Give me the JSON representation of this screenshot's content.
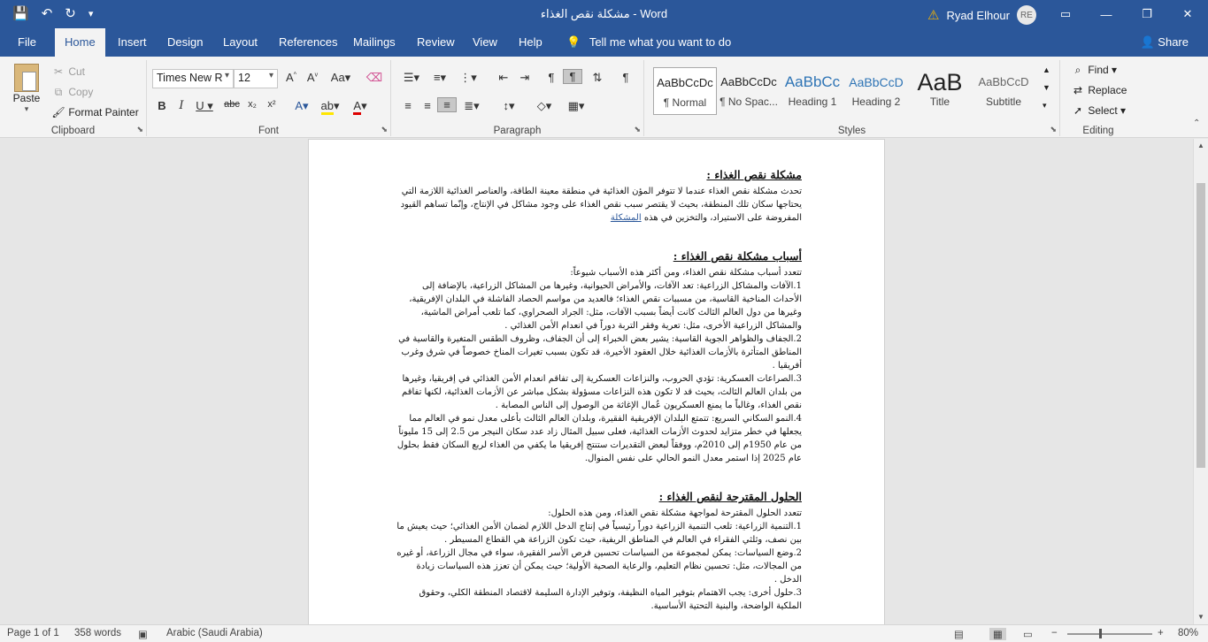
{
  "window": {
    "title": "مشكلة نقص الغذاء  -  Word",
    "user_name": "Ryad Elhour",
    "user_initials": "RE",
    "qat": {
      "save_icon": "💾",
      "undo_icon": "↶",
      "redo_icon": "↻",
      "customize_icon": "▾"
    },
    "warning_icon": "⚠",
    "controls": {
      "ribbon_display_icon": "▭",
      "minimize_icon": "—",
      "restore_icon": "❐",
      "close_icon": "✕"
    }
  },
  "tabs": {
    "items": [
      "File",
      "Home",
      "Insert",
      "Design",
      "Layout",
      "References",
      "Mailings",
      "Review",
      "View",
      "Help"
    ],
    "active": "Home",
    "tell_me": "Tell me what you want to do",
    "share": "Share"
  },
  "clipboard": {
    "paste": "Paste",
    "cut": "Cut",
    "copy": "Copy",
    "format_painter": "Format Painter",
    "label": "Clipboard"
  },
  "font": {
    "name": "Times New R",
    "size": "12",
    "label": "Font"
  },
  "paragraph": {
    "label": "Paragraph"
  },
  "styles": {
    "label": "Styles",
    "items": [
      {
        "preview": "AaBbCcDc",
        "name": "¶ Normal"
      },
      {
        "preview": "AaBbCcDc",
        "name": "¶ No Spac..."
      },
      {
        "preview": "AaBbCc",
        "name": "Heading 1"
      },
      {
        "preview": "AaBbCcD",
        "name": "Heading 2"
      },
      {
        "preview": "AaB",
        "name": "Title"
      },
      {
        "preview": "AaBbCcD",
        "name": "Subtitle"
      }
    ]
  },
  "editing": {
    "find": "Find",
    "replace": "Replace",
    "select": "Select",
    "label": "Editing"
  },
  "document": {
    "h1": "مشكلة نقص الغذاء :",
    "p1": "تحدث مشكلة نقص الغذاء عندما لا تتوفر المؤن الغذائية في منطقة معينة الطاقة، والعناصر الغذائية اللازمة التي يحتاجها سكان تلك المنطقة، بحيث لا يقتصر سبب نقص الغذاء على وجود مشاكل في الإنتاج، وإنّما تساهم القيود المفروضة على الاستيراد، والتخزين في هذه",
    "p1_link": "المشكلة",
    "h2": "أسباب مشكلة نقص الغذاء :",
    "p2_intro": "تتعدد أسباب مشكلة نقص الغذاء، ومن أكثر هذه الأسباب شيوعاً:",
    "p2_1": "1.الآفات والمشاكل الزراعية: تعد الآفات، والأمراض الحيوانية، وغيرها من المشاكل الزراعية، بالإضافة إلى الأحداث المناخية القاسية، من مسببات نقص الغذاء؛ فالعديد من مواسم الحصاد الفاشلة في البلدان الإفريقية، وغيرها من دول العالم الثالث كانت أيضاً بسبب الآفات، مثل: الجراد الصحراوي، كما تلعب أمراض الماشية، والمشاكل الزراعية الأخرى، مثل: تعرية وفقر التربة دوراً في انعدام الأمن الغذائي .",
    "p2_2": "2.الجفاف والظواهر الجوية القاسية: يشير بعض الخبراء إلى أن الجفاف، وظروف الطقس المتغيرة والقاسية في المناطق المتأثرة بالأزمات الغذائية خلال العقود الأخيرة، قد تكون بسبب تغيرات المناخ خصوصاً في شرق وغرب أفريقيا .",
    "p2_3": "3.الصراعات العسكرية: تؤدي الحروب، والنزاعات العسكرية إلى تفاقم انعدام الأمن الغذائي في إفريقيا، وغيرها من بلدان العالم الثالث، بحيث قد لا تكون هذه النزاعات مسؤولة بشكل مباشر عن الأزمات الغذائية، لكنها تفاقم نقص الغذاء، وغالباً ما يمنع العسكريون عُمال الإغاثة من الوصول إلى الناس المصابة .",
    "p2_4": "4.النمو السكاني السريع: تتمتع البلدان الإفريقية الفقيرة، وبلدان العالم الثالث بأعلى معدل نمو في العالم مما يجعلها في خطر متزايد لحدوث الأزمات الغذائية، فعلى سبيل المثال زاد عدد سكان النيجر من 2.5 إلى 15 مليوناً من عام 1950م إلى 2010م، ووفقاً لبعض التقديرات ستنتج إفريقيا ما يكفي من الغذاء لربع السكان فقط بحلول عام 2025 إذا استمر معدل النمو الحالي على نفس المنوال.",
    "h3": "الحلول المقترحة لنقص الغذاء :",
    "p3_intro": "تتعدد الحلول المقترحة لمواجهة مشكلة نقص الغذاء، ومن هذه الحلول:",
    "p3_1": "1.التنمية الزراعية: تلعب التنمية الزراعية دوراً رئيسياً في إنتاج الدخل اللازم لضمان الأمن الغذائي؛ حيث يعيش ما بين نصف، وثلثي الفقراء في العالم في المناطق الريفية، حيث تكون الزراعة هي القطاع المسيطر .",
    "p3_2": "2.وضع السياسات: يمكن لمجموعة من السياسات تحسين فرص الأسر الفقيرة، سواء في مجال الزراعة، أو غيره من المجالات، مثل: تحسين نظام التعليم، والرعاية الصحية الأولية؛ حيث يمكن أن تعزز هذه السياسات زيادة الدخل .",
    "p3_3": "3.حلول أخرى: يجب الاهتمام بتوفير المياه النظيفة، وتوفير الإدارة السليمة لاقتصاد المنطقة الكلي، وحقوق الملكية الواضحة، والبنية التحتية الأساسية."
  },
  "statusbar": {
    "page": "Page 1 of 1",
    "words": "358 words",
    "language": "Arabic (Saudi Arabia)",
    "zoom": "80%"
  }
}
